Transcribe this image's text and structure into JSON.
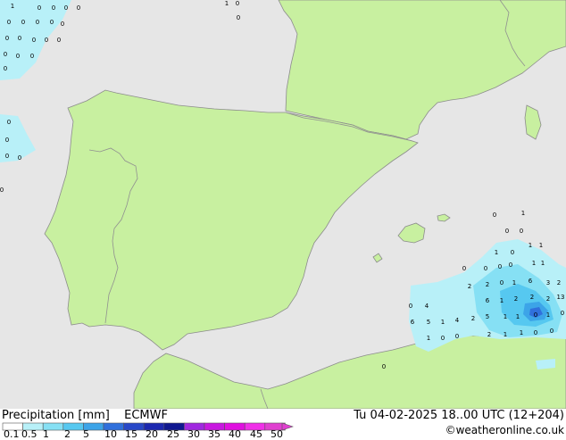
{
  "title": "Precipitation [mm]",
  "model": "ECMWF",
  "valid_time": "Tu 04-02-2025 18..00 UTC (12+204)",
  "credit": "©weatheronline.co.uk",
  "legend": {
    "ticks": [
      "0.1",
      "0.5",
      "1",
      "2",
      "5",
      "10",
      "15",
      "20",
      "25",
      "30",
      "35",
      "40",
      "45",
      "50"
    ],
    "colors": [
      "#ffffff",
      "#b8f0f8",
      "#86e0f4",
      "#56c8f0",
      "#3ca4e8",
      "#3070dc",
      "#2848c8",
      "#1c28b0",
      "#101890",
      "#a028e0",
      "#c818e0",
      "#e010e0",
      "#f030e8",
      "#e040d0"
    ]
  },
  "colors": {
    "sea": "#e6e6e6",
    "land": "#c8f0a0",
    "coast": "#8c8c8c",
    "border": "#909090"
  },
  "precip_values": [
    "1",
    "0",
    "0",
    "0",
    "0",
    "1",
    "0",
    "0",
    "0",
    "0",
    "0",
    "0",
    "0",
    "0",
    "0",
    "0",
    "0",
    "0",
    "0",
    "0",
    "0",
    "0",
    "0",
    "0",
    "0",
    "0",
    "0",
    "1",
    "0",
    "0",
    "0",
    "1",
    "1",
    "0",
    "0",
    "0",
    "0",
    "1",
    "1",
    "1",
    "0",
    "2",
    "2",
    "0",
    "1",
    "6",
    "3",
    "2",
    "6",
    "1",
    "2",
    "2",
    "2",
    "13",
    "5",
    "1",
    "1",
    "0",
    "1",
    "0",
    "0",
    "4",
    "6",
    "5",
    "1",
    "4",
    "2",
    "2",
    "1",
    "1",
    "0",
    "0",
    "1",
    "0",
    "0",
    "0"
  ]
}
